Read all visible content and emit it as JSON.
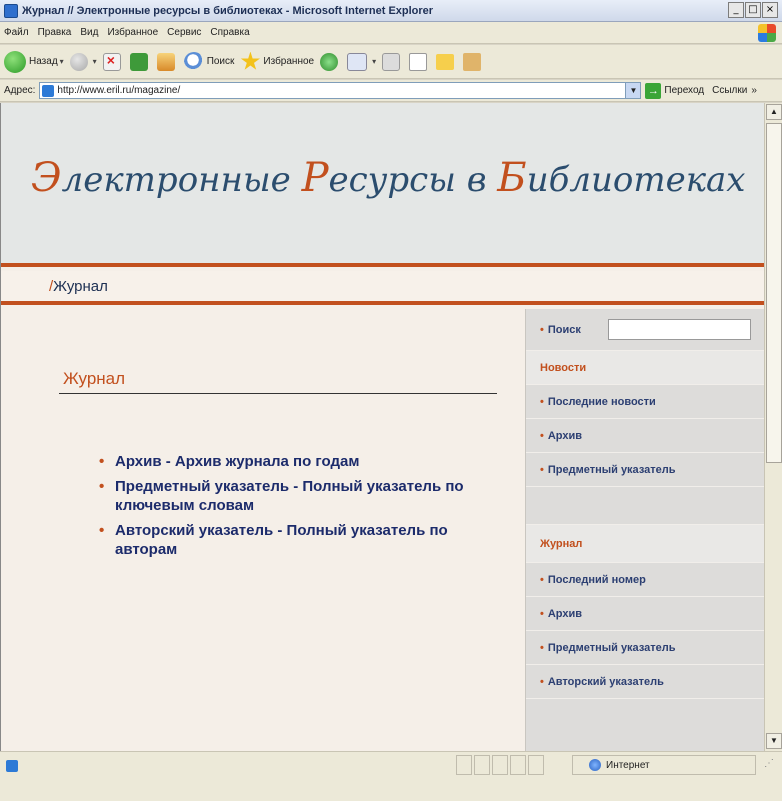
{
  "window": {
    "title": "Журнал // Электронные ресурсы в библиотеках - Microsoft Internet Explorer",
    "btn_min": "_",
    "btn_max": "□",
    "btn_close": "×"
  },
  "menu": [
    "Файл",
    "Правка",
    "Вид",
    "Избранное",
    "Сервис",
    "Справка"
  ],
  "toolbar": {
    "back_label": "Назад",
    "search_label": "Поиск",
    "favorites_label": "Избранное"
  },
  "address": {
    "label": "Адрес:",
    "url": "http://www.eril.ru/magazine/",
    "go_label": "Переход",
    "links_label": "Ссылки",
    "chevron": "»"
  },
  "site": {
    "title_parts": [
      {
        "cap": "Э",
        "rest": "лектронные "
      },
      {
        "cap": "Р",
        "rest": "есурсы в "
      },
      {
        "cap": "Б",
        "rest": "иблиотеках"
      }
    ],
    "breadcrumb_slash": "/",
    "breadcrumb": "Журнал",
    "main_title": "Журнал",
    "main_links": [
      "Архив - Архив журнала по годам",
      "Предметный указатель - Полный указатель по ключевым словам",
      "Авторский указатель - Полный указатель по авторам"
    ],
    "bullet": "•"
  },
  "sidebar": {
    "search_label": "Поиск",
    "search_value": "",
    "news_header": "Новости",
    "news_items": [
      "Последние новости",
      "Архив",
      "Предметный указатель"
    ],
    "journal_header": "Журнал",
    "journal_items": [
      "Последний номер",
      "Архив",
      "Предметный указатель",
      "Авторский указатель"
    ],
    "bullet": "•"
  },
  "status": {
    "zone": "Интернет"
  },
  "colors": {
    "accent": "#c2501e",
    "title_blue": "#2b4d6e",
    "link_blue": "#1c2b6b",
    "sidebar_bg": "#dddcda"
  }
}
